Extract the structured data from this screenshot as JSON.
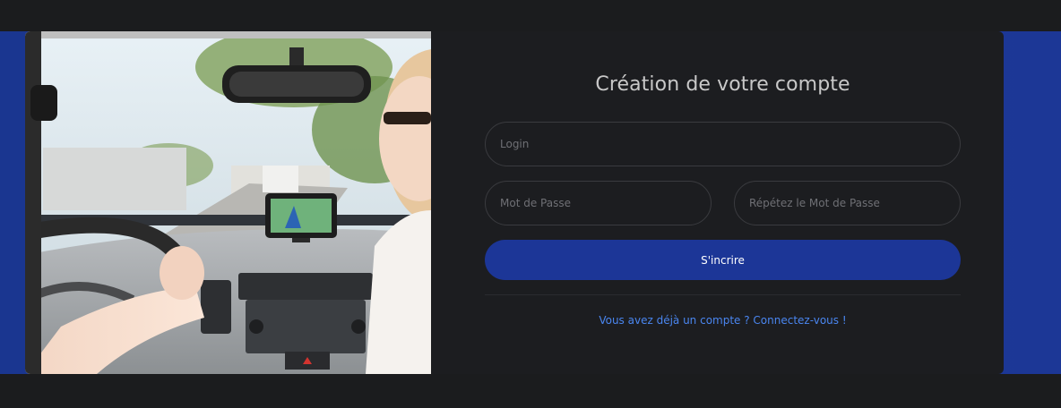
{
  "form": {
    "title": "Création de votre compte",
    "login_placeholder": "Login",
    "password_placeholder": "Mot de Passe",
    "password_repeat_placeholder": "Répétez le Mot de Passe",
    "submit_label": "S'incrire",
    "login_link": "Vous avez déjà un compte ? Connectez-vous !"
  },
  "colors": {
    "accent": "#1c3697",
    "link": "#4a86f0",
    "background": "#1b1c1e",
    "card": "#1c1d20"
  },
  "image": {
    "icon": "car-gps-photo"
  }
}
